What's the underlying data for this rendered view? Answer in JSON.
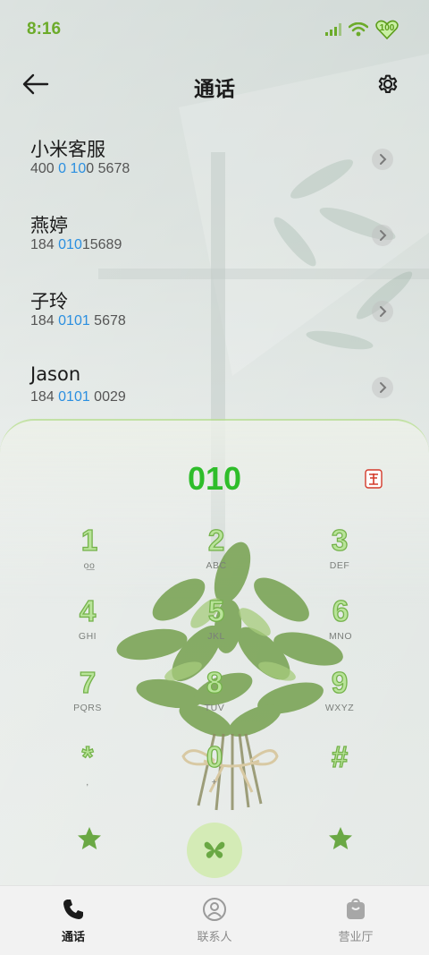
{
  "status_bar": {
    "time": "8:16",
    "battery": "100",
    "accent_color": "#6cab2a"
  },
  "header": {
    "title": "通话",
    "back_icon": "arrow-left-icon",
    "settings_icon": "gear-icon"
  },
  "contacts": [
    {
      "name": "小米客服",
      "num_pre": "400 ",
      "num_hl1": "0",
      "num_mid": " ",
      "num_hl2": "10",
      "num_post": "0 5678"
    },
    {
      "name": "燕婷",
      "num_pre": "184 ",
      "num_hl1": "010",
      "num_mid": "",
      "num_hl2": "",
      "num_post": "15689"
    },
    {
      "name": "子玲",
      "num_pre": "184 ",
      "num_hl1": "0101",
      "num_mid": "",
      "num_hl2": "",
      "num_post": " 5678"
    },
    {
      "name": "Jason",
      "num_pre": "184 ",
      "num_hl1": "0101",
      "num_mid": "",
      "num_hl2": "",
      "num_post": " 0029"
    }
  ],
  "dialer": {
    "number": "010",
    "highlight_color": "#2b8fe0",
    "number_color": "#2ebd2a",
    "keys": [
      {
        "digit": "1",
        "letters": "ᴏ͟ᴏ"
      },
      {
        "digit": "2",
        "letters": "ABC"
      },
      {
        "digit": "3",
        "letters": "DEF"
      },
      {
        "digit": "4",
        "letters": "GHI"
      },
      {
        "digit": "5",
        "letters": "JKL"
      },
      {
        "digit": "6",
        "letters": "MNO"
      },
      {
        "digit": "7",
        "letters": "PQRS"
      },
      {
        "digit": "8",
        "letters": "TUV"
      },
      {
        "digit": "9",
        "letters": "WXYZ"
      },
      {
        "digit": "*",
        "letters": ","
      },
      {
        "digit": "0",
        "letters": "+"
      },
      {
        "digit": "#",
        "letters": ""
      }
    ]
  },
  "bottom_nav": {
    "items": [
      {
        "label": "通话",
        "icon": "phone-icon",
        "active": true
      },
      {
        "label": "联系人",
        "icon": "person-icon",
        "active": false
      },
      {
        "label": "营业厅",
        "icon": "bag-icon",
        "active": false
      }
    ]
  }
}
